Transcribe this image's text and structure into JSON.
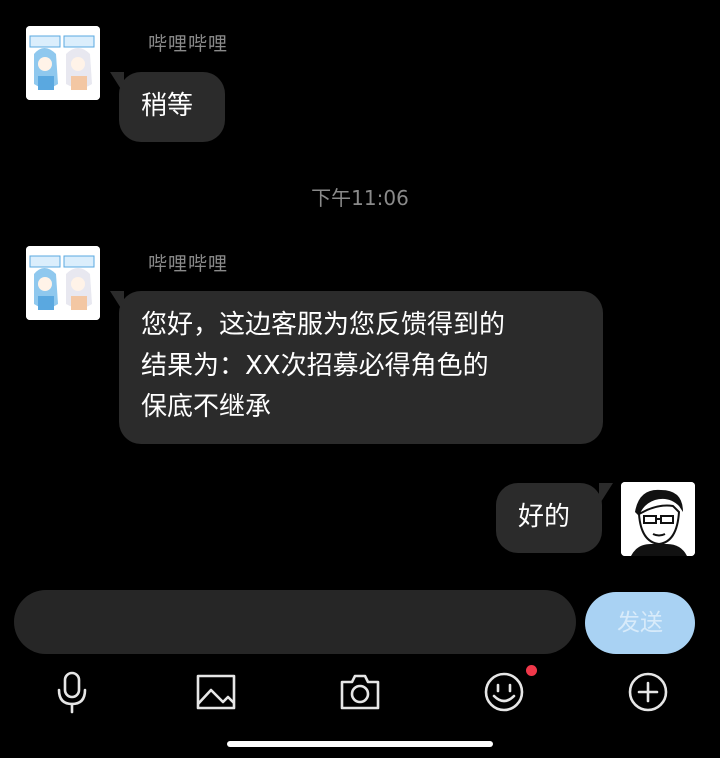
{
  "messages": [
    {
      "sender": "哔哩哔哩",
      "text": "稍等"
    },
    {
      "sender": "哔哩哔哩",
      "lines": [
        "您好，这边客服为您反馈得到的",
        "结果为：XX次招募必得角色的",
        "保底不继承"
      ]
    },
    {
      "text": "好的"
    }
  ],
  "timestamp": "下午11:06",
  "composer": {
    "placeholder": "",
    "send_label": "发送"
  },
  "toolbar": [
    "microphone-icon",
    "image-icon",
    "camera-icon",
    "emoji-icon",
    "plus-icon"
  ],
  "badge_color": "#f0384a",
  "send_color": "#a9d2f3"
}
